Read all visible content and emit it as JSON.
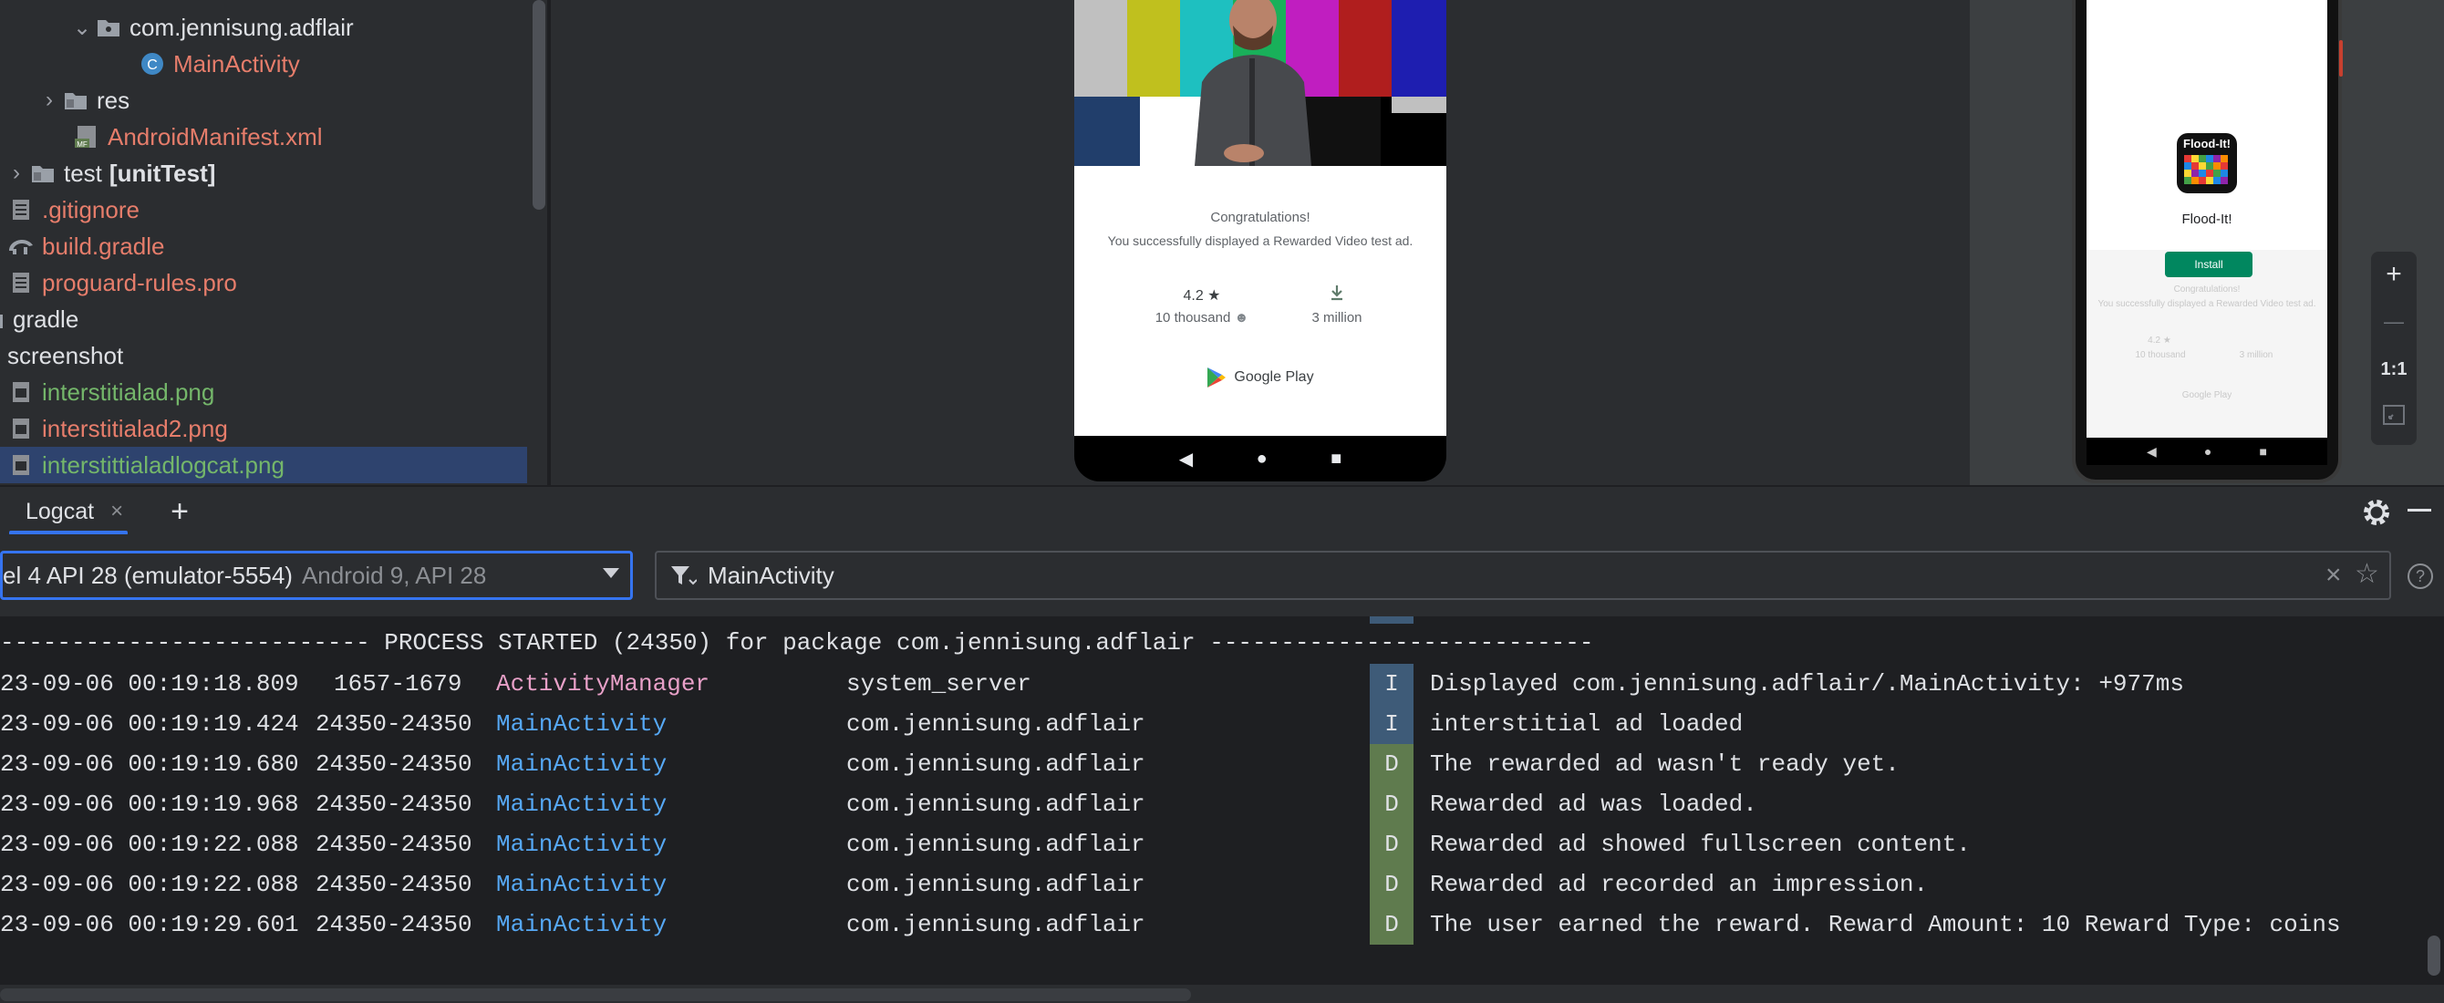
{
  "project_tree": {
    "items": [
      {
        "label": "com.jennisung.adflair",
        "bold": "",
        "icon": "folder-icon",
        "expanded": true
      },
      {
        "label": "MainActivity",
        "bold": "",
        "icon": "class-icon"
      },
      {
        "label": "res",
        "bold": "",
        "icon": "folder-icon",
        "expanded": false
      },
      {
        "label": "AndroidManifest.xml",
        "bold": "",
        "icon": "manifest-icon"
      },
      {
        "label": "test",
        "bold": "[unitTest]",
        "icon": "folder-icon",
        "expanded": false
      },
      {
        "label": ".gitignore",
        "bold": "",
        "icon": "file-icon"
      },
      {
        "label": "build.gradle",
        "bold": "",
        "icon": "gradle-icon"
      },
      {
        "label": "proguard-rules.pro",
        "bold": "",
        "icon": "file-icon"
      },
      {
        "label": "gradle",
        "bold": "",
        "icon": "folder-icon"
      },
      {
        "label": "screenshot",
        "bold": "",
        "icon": "folder-icon"
      },
      {
        "label": "interstitialad.png",
        "bold": "",
        "icon": "image-file-icon"
      },
      {
        "label": "interstitialad2.png",
        "bold": "",
        "icon": "image-file-icon"
      },
      {
        "label": "interstittialadlogcat.png",
        "bold": "",
        "icon": "image-file-icon",
        "selected": true
      }
    ]
  },
  "preview": {
    "rewarded_ad": {
      "title": "Congratulations!",
      "message": "You successfully displayed a Rewarded Video test ad.",
      "rating": "4.2 ★",
      "reviews": "10 thousand",
      "downloads": "3 million",
      "store": "Google Play"
    },
    "small_phone": {
      "app_name": "Flood-It!",
      "icon_text": "Flood-It!",
      "install_label": "Install",
      "faint_title": "Congratulations!",
      "faint_message": "You successfully displayed a Rewarded Video test ad.",
      "faint_rating": "4.2 ★",
      "faint_reviews": "10 thousand",
      "faint_downloads": "3 million",
      "faint_store": "Google Play"
    },
    "zoom": {
      "zoom_in": "+",
      "zoom_out": "—",
      "one_to_one": "1:1"
    }
  },
  "logcat": {
    "tab_label": "Logcat",
    "tab_close": "×",
    "add_tab": "+",
    "device": {
      "name": "el 4 API 28 (emulator-5554)",
      "api": "Android 9, API 28"
    },
    "filter": {
      "value": "MainActivity"
    },
    "help": "?",
    "process_banner": "-------------------------- PROCESS STARTED (24350) for package com.jennisung.adflair ---------------------------",
    "rows": [
      {
        "timestamp": "23-09-06 00:19:18.809",
        "pid": "1657-1679",
        "tag": "ActivityManager",
        "process": "system_server",
        "level": "I",
        "message": "Displayed com.jennisung.adflair/.MainActivity: +977ms"
      },
      {
        "timestamp": "23-09-06 00:19:19.424",
        "pid": "24350-24350",
        "tag": "MainActivity",
        "process": "com.jennisung.adflair",
        "level": "I",
        "message": "interstitial ad loaded"
      },
      {
        "timestamp": "23-09-06 00:19:19.680",
        "pid": "24350-24350",
        "tag": "MainActivity",
        "process": "com.jennisung.adflair",
        "level": "D",
        "message": "The rewarded ad wasn't ready yet."
      },
      {
        "timestamp": "23-09-06 00:19:19.968",
        "pid": "24350-24350",
        "tag": "MainActivity",
        "process": "com.jennisung.adflair",
        "level": "D",
        "message": "Rewarded ad was loaded."
      },
      {
        "timestamp": "23-09-06 00:19:22.088",
        "pid": "24350-24350",
        "tag": "MainActivity",
        "process": "com.jennisung.adflair",
        "level": "D",
        "message": "Rewarded ad showed fullscreen content."
      },
      {
        "timestamp": "23-09-06 00:19:22.088",
        "pid": "24350-24350",
        "tag": "MainActivity",
        "process": "com.jennisung.adflair",
        "level": "D",
        "message": "Rewarded ad recorded an impression."
      },
      {
        "timestamp": "23-09-06 00:19:29.601",
        "pid": "24350-24350",
        "tag": "MainActivity",
        "process": "com.jennisung.adflair",
        "level": "D",
        "message": "The user earned the reward. Reward Amount: 10 Reward Type: coins"
      }
    ]
  },
  "colors": {
    "accent": "#3574f0",
    "tag_main": "#56a8f5",
    "tag_activity_manager": "#e8a0c8",
    "level_info_bg": "#3e5b78",
    "level_debug_bg": "#5f7b4e",
    "file_modified_red": "#e67d6b",
    "file_added_green": "#74b66a"
  }
}
